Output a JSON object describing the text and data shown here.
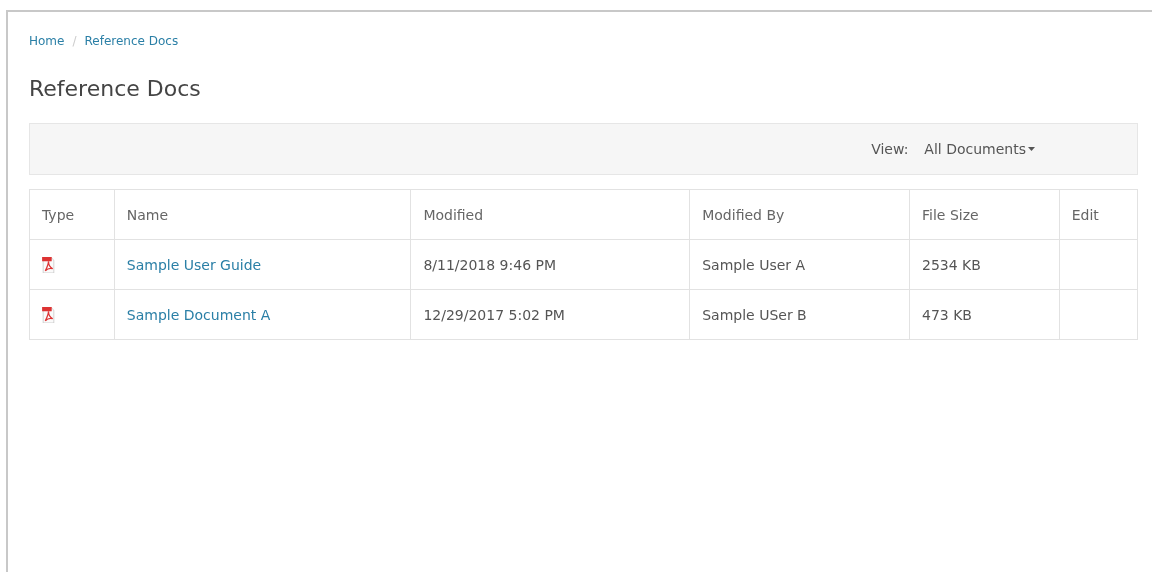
{
  "breadcrumb": [
    {
      "label": "Home"
    },
    {
      "label": "Reference Docs"
    }
  ],
  "breadcrumb_separator": "/",
  "title": "Reference Docs",
  "view": {
    "label": "View:",
    "value": "All Documents"
  },
  "table": {
    "columns": [
      "Type",
      "Name",
      "Modified",
      "Modified By",
      "File Size",
      "Edit"
    ],
    "rows": [
      {
        "kind": "pdf",
        "name": "Sample User Guide",
        "modified": "8/11/2018 9:46 PM",
        "modified_by": "Sample User A",
        "file_size": "2534 KB"
      },
      {
        "kind": "pdf",
        "name": "Sample Document A",
        "modified": "12/29/2017 5:02 PM",
        "modified_by": "Sample USer B",
        "file_size": "473 KB"
      }
    ]
  }
}
